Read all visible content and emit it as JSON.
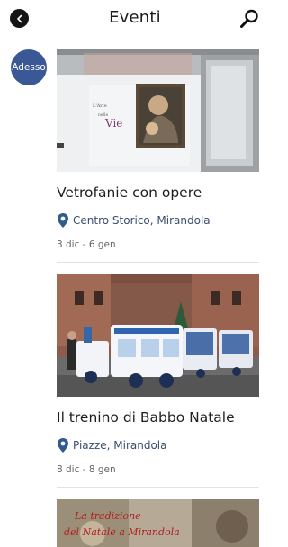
{
  "header": {
    "title": "Eventi",
    "back_icon": "chevron-left-icon",
    "search_icon": "search-icon"
  },
  "now_badge": {
    "label": "Adesso",
    "color": "#3b5896"
  },
  "events": [
    {
      "title": "Vetrofanie con opere",
      "location": "Centro Storico, Mirandola",
      "dates": "3 dic - 6 gen",
      "image_text": [
        "L'Arte",
        "nelle",
        "Vie"
      ]
    },
    {
      "title": "Il trenino di Babbo Natale",
      "location": "Piazze, Mirandola",
      "dates": "8 dic - 8 gen"
    },
    {
      "image_text": [
        "La tradizione",
        "del Natale a Mirandola"
      ]
    }
  ],
  "colors": {
    "accent": "#3b5896",
    "location_pin": "#2f5b8f",
    "location_text": "#3a4e6e"
  }
}
